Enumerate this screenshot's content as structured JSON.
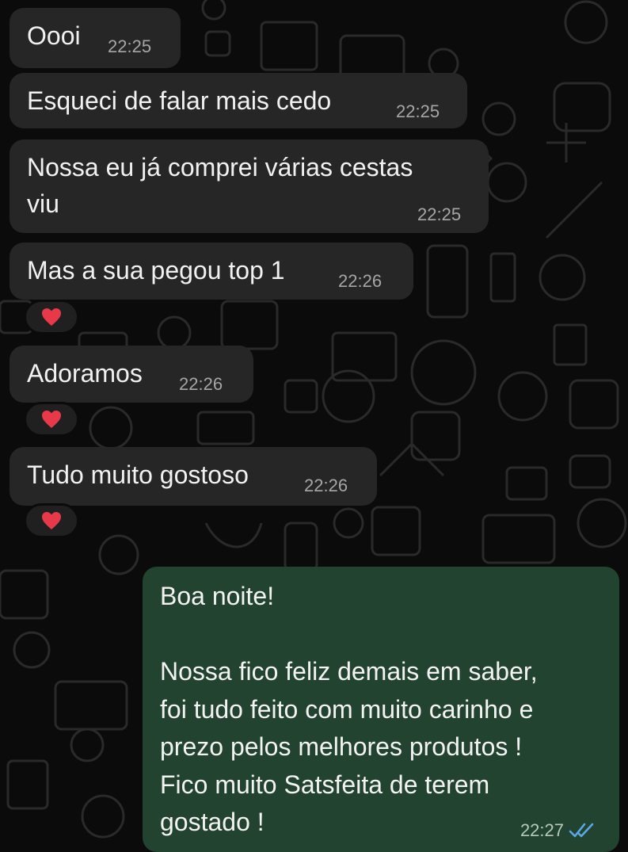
{
  "messages": [
    {
      "text": "Oooi",
      "time": "22:25"
    },
    {
      "text": "Esqueci de falar mais cedo",
      "time": "22:25"
    },
    {
      "text": "Nossa eu já comprei várias cestas\nviu",
      "time": "22:25"
    },
    {
      "text": "Mas a sua pegou top 1",
      "time": "22:26",
      "reaction": "heart"
    },
    {
      "text": "Adoramos",
      "time": "22:26",
      "reaction": "heart"
    },
    {
      "text": "Tudo muito gostoso",
      "time": "22:26",
      "reaction": "heart"
    }
  ],
  "outgoing": {
    "text": "Boa noite!\n\nNossa fico feliz demais em saber,\nfoi tudo feito com muito carinho e\nprezo pelos melhores produtos !\nFico muito Satsfeita de terem\ngostado !",
    "time": "22:27",
    "status_icon": "double-check-read-icon"
  },
  "colors": {
    "incoming_bubble": "#262626",
    "outgoing_bubble": "#21432f",
    "read_tick": "#5aa9e6",
    "heart": "#e8394a"
  }
}
